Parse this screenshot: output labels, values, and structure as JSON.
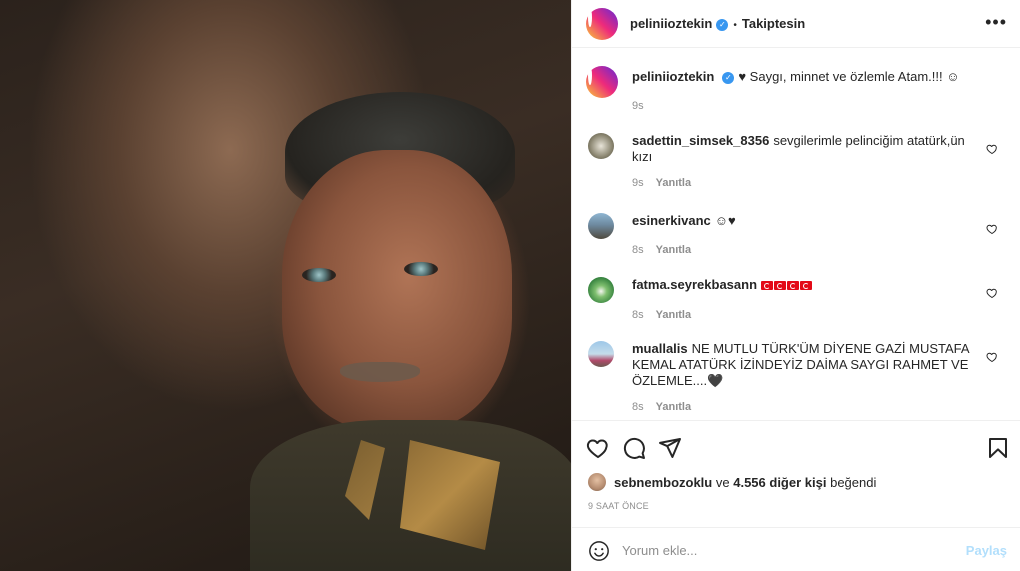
{
  "post": {
    "author": "peliniioztekin",
    "follow_status": "Takiptesin",
    "dot": "•",
    "more_label": "•••"
  },
  "caption": {
    "username": "peliniioztekin",
    "text": "♥ Saygı, minnet ve özlemle Atam.!!! ☺",
    "time": "9s"
  },
  "comments": [
    {
      "username": "sadettin_simsek_8356",
      "text": "sevgilerimle pelinciğim atatürk,ün kızı",
      "time": "9s",
      "reply": "Yanıtla"
    },
    {
      "username": "esinerkivanc",
      "text": "☺♥",
      "time": "8s",
      "reply": "Yanıtla"
    },
    {
      "username": "fatma.seyrekbasann",
      "text": "",
      "time": "8s",
      "reply": "Yanıtla"
    },
    {
      "username": "muallalis",
      "text": "NE MUTLU TÜRK'ÜM DİYENE GAZİ MUSTAFA KEMAL ATATÜRK İZİNDEYİZ DAİMA SAYGI RAHMET VE ÖZLEMLE....🖤",
      "time": "8s",
      "reply": "Yanıtla"
    }
  ],
  "likes": {
    "first_user": "sebnembozoklu",
    "connector": "ve",
    "others": "4.556 diğer kişi",
    "suffix": "beğendi"
  },
  "timestamp": "9 SAAT ÖNCE",
  "comment_box": {
    "placeholder": "Yorum ekle...",
    "post_label": "Paylaş"
  },
  "colors": {
    "verified": "#3897f0",
    "muted": "#8e8e8e",
    "post_disabled": "#b2dffc",
    "flag_red": "#e30a17"
  },
  "icons": {
    "like": "heart-icon",
    "comment": "comment-icon",
    "share": "paper-plane-icon",
    "save": "bookmark-icon",
    "emoji": "smiley-icon"
  }
}
